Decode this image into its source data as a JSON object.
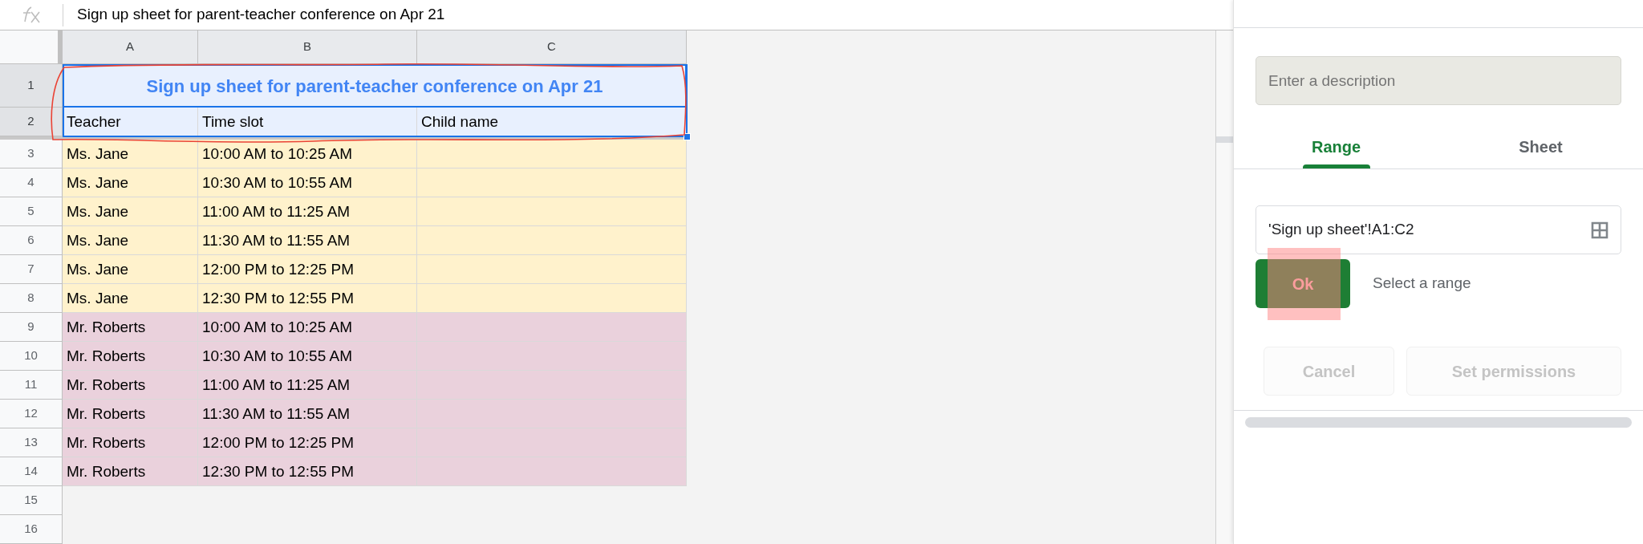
{
  "formula_bar": {
    "value": "Sign up sheet for parent-teacher conference on Apr 21"
  },
  "sheet": {
    "columns": [
      "A",
      "B",
      "C"
    ],
    "rows": [
      {
        "kind": "title",
        "row_number": "1",
        "selected": true,
        "cells": [
          "Sign up sheet for parent-teacher conference on Apr 21"
        ]
      },
      {
        "kind": "data",
        "row_number": "2",
        "selected": true,
        "cells": [
          "Teacher",
          "Time slot",
          "Child name"
        ]
      },
      {
        "kind": "data",
        "row_number": "3",
        "selected": false,
        "color": "#fff2cc",
        "cells": [
          "Ms. Jane",
          "10:00 AM to 10:25 AM"
        ]
      },
      {
        "kind": "data",
        "row_number": "4",
        "selected": false,
        "color": "#fff2cc",
        "cells": [
          "Ms. Jane",
          "10:30 AM to 10:55 AM"
        ]
      },
      {
        "kind": "data",
        "row_number": "5",
        "selected": false,
        "color": "#fff2cc",
        "cells": [
          "Ms. Jane",
          "11:00 AM to 11:25 AM"
        ]
      },
      {
        "kind": "data",
        "row_number": "6",
        "selected": false,
        "color": "#fff2cc",
        "cells": [
          "Ms. Jane",
          "11:30 AM to 11:55 AM"
        ]
      },
      {
        "kind": "data",
        "row_number": "7",
        "selected": false,
        "color": "#fff2cc",
        "cells": [
          "Ms. Jane",
          "12:00 PM to 12:25 PM"
        ]
      },
      {
        "kind": "data",
        "row_number": "8",
        "selected": false,
        "color": "#fff2cc",
        "cells": [
          "Ms. Jane",
          "12:30 PM to 12:55 PM"
        ]
      },
      {
        "kind": "data",
        "row_number": "9",
        "selected": false,
        "color": "#ead1dc",
        "cells": [
          "Mr. Roberts",
          "10:00 AM to 10:25 AM"
        ]
      },
      {
        "kind": "data",
        "row_number": "10",
        "selected": false,
        "color": "#ead1dc",
        "cells": [
          "Mr. Roberts",
          "10:30 AM to 10:55 AM"
        ]
      },
      {
        "kind": "data",
        "row_number": "11",
        "selected": false,
        "color": "#ead1dc",
        "cells": [
          "Mr. Roberts",
          "11:00 AM to 11:25 AM"
        ]
      },
      {
        "kind": "data",
        "row_number": "12",
        "selected": false,
        "color": "#ead1dc",
        "cells": [
          "Mr. Roberts",
          "11:30 AM to 11:55 AM"
        ]
      },
      {
        "kind": "data",
        "row_number": "13",
        "selected": false,
        "color": "#ead1dc",
        "cells": [
          "Mr. Roberts",
          "12:00 PM to 12:25 PM"
        ]
      },
      {
        "kind": "data",
        "row_number": "14",
        "selected": false,
        "color": "#ead1dc",
        "cells": [
          "Mr. Roberts",
          "12:30 PM to 12:55 PM"
        ]
      },
      {
        "kind": "empty",
        "row_number": "15",
        "selected": false
      },
      {
        "kind": "empty",
        "row_number": "16",
        "selected": false
      }
    ]
  },
  "panel": {
    "description_field": {
      "placeholder": "Enter a description"
    },
    "tabs": [
      {
        "label": "Range",
        "selected": true
      },
      {
        "label": "Sheet",
        "selected": false
      }
    ],
    "range_field": {
      "value": "'Sign up sheet'!A1:C2"
    },
    "ok_button": {
      "label": "Ok"
    },
    "hint": "Select a range",
    "buttons": [
      {
        "label": "Cancel",
        "disabled": true
      },
      {
        "label": "Set permissions",
        "disabled": true
      }
    ]
  }
}
